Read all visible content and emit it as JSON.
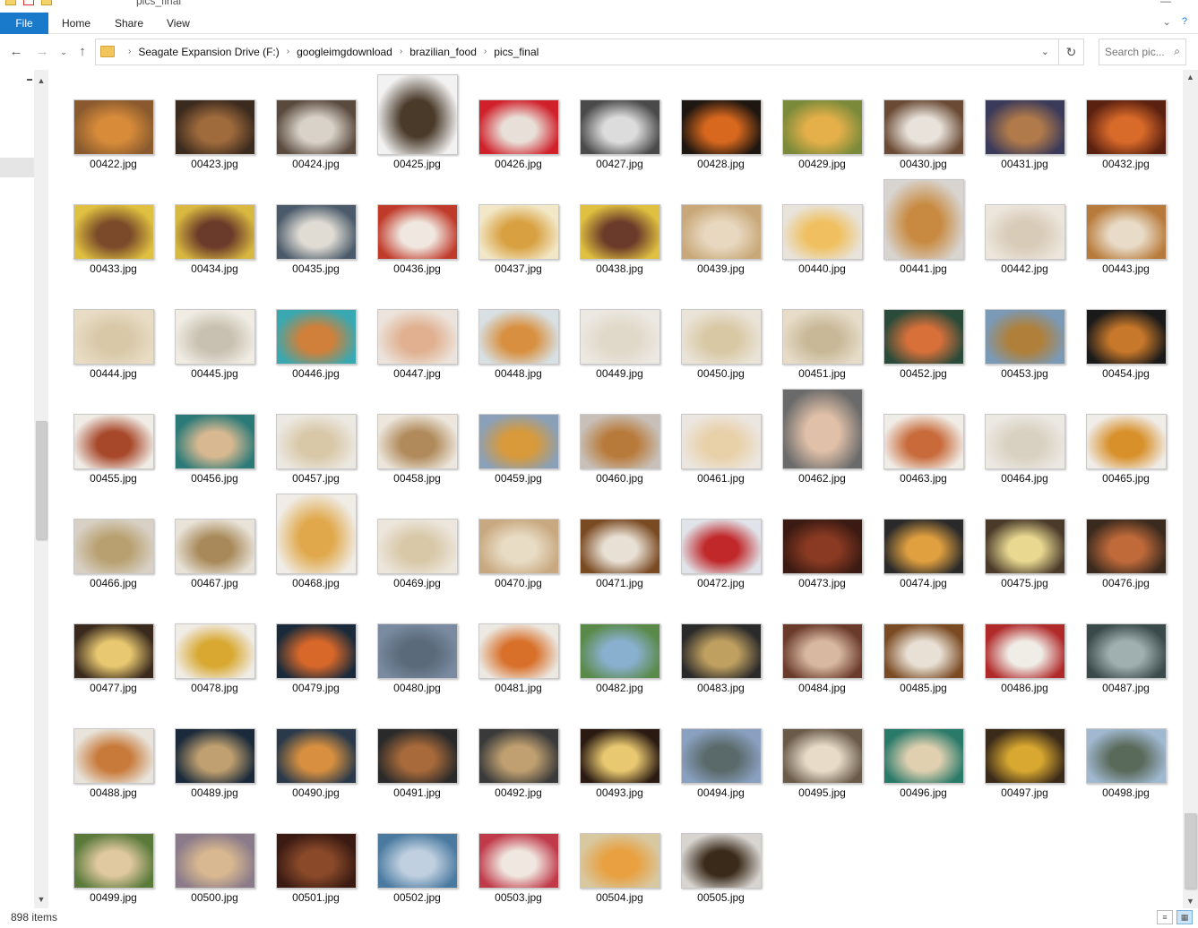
{
  "window": {
    "title": "pics_final"
  },
  "ribbon": {
    "tabs": [
      {
        "label": "File"
      },
      {
        "label": "Home"
      },
      {
        "label": "Share"
      },
      {
        "label": "View"
      }
    ]
  },
  "address": {
    "breadcrumbs": [
      "Seagate Expansion Drive (F:)",
      "googleimgdownload",
      "brazilian_food",
      "pics_final"
    ]
  },
  "search": {
    "placeholder": "Search pic..."
  },
  "status": {
    "item_count": "898 items"
  },
  "files": [
    {
      "name": "00422.jpg",
      "c1": "#8a5a2e",
      "c2": "#d88c3a"
    },
    {
      "name": "00423.jpg",
      "c1": "#3b2a1e",
      "c2": "#a06b3c"
    },
    {
      "name": "00424.jpg",
      "c1": "#5a4a3e",
      "c2": "#d9d2c9"
    },
    {
      "name": "00425.jpg",
      "c1": "#f2f2f2",
      "c2": "#4a3a2a",
      "tall": true
    },
    {
      "name": "00426.jpg",
      "c1": "#d0202a",
      "c2": "#e8e0d8"
    },
    {
      "name": "00427.jpg",
      "c1": "#4a4a4a",
      "c2": "#dcdcdc"
    },
    {
      "name": "00428.jpg",
      "c1": "#1e1610",
      "c2": "#d8681e"
    },
    {
      "name": "00429.jpg",
      "c1": "#7a8a3a",
      "c2": "#e5b04a"
    },
    {
      "name": "00430.jpg",
      "c1": "#6a4a34",
      "c2": "#e8e2da"
    },
    {
      "name": "00431.jpg",
      "c1": "#3a3a5a",
      "c2": "#b07a4a"
    },
    {
      "name": "00432.jpg",
      "c1": "#5a2010",
      "c2": "#d86a2a"
    },
    {
      "name": "00433.jpg",
      "c1": "#e0c040",
      "c2": "#7a4a2a"
    },
    {
      "name": "00434.jpg",
      "c1": "#d8b840",
      "c2": "#6a3a2a"
    },
    {
      "name": "00435.jpg",
      "c1": "#4a5a6a",
      "c2": "#e0dcd4"
    },
    {
      "name": "00436.jpg",
      "c1": "#c03a2a",
      "c2": "#f0e8e0"
    },
    {
      "name": "00437.jpg",
      "c1": "#f2e8c8",
      "c2": "#d8a040"
    },
    {
      "name": "00438.jpg",
      "c1": "#e0c040",
      "c2": "#6a3a2a"
    },
    {
      "name": "00439.jpg",
      "c1": "#c8a878",
      "c2": "#e8d8c0"
    },
    {
      "name": "00440.jpg",
      "c1": "#e8e4dc",
      "c2": "#f0c060"
    },
    {
      "name": "00441.jpg",
      "c1": "#d8d4d0",
      "c2": "#c88a40",
      "tall": true
    },
    {
      "name": "00442.jpg",
      "c1": "#ece6dc",
      "c2": "#d8cbb8"
    },
    {
      "name": "00443.jpg",
      "c1": "#b87a3a",
      "c2": "#e8dcc8"
    },
    {
      "name": "00444.jpg",
      "c1": "#e8dcc4",
      "c2": "#d8c8a8"
    },
    {
      "name": "00445.jpg",
      "c1": "#f0ece4",
      "c2": "#c8c0b0"
    },
    {
      "name": "00446.jpg",
      "c1": "#3aa8b0",
      "c2": "#d0803a"
    },
    {
      "name": "00447.jpg",
      "c1": "#ece4dc",
      "c2": "#e0b090"
    },
    {
      "name": "00448.jpg",
      "c1": "#d8e0e4",
      "c2": "#d89040"
    },
    {
      "name": "00449.jpg",
      "c1": "#ece8e2",
      "c2": "#e0d8c8"
    },
    {
      "name": "00450.jpg",
      "c1": "#eae4d8",
      "c2": "#d8c8a4"
    },
    {
      "name": "00451.jpg",
      "c1": "#e6dcc8",
      "c2": "#c8b898"
    },
    {
      "name": "00452.jpg",
      "c1": "#2a4a3a",
      "c2": "#d8703a"
    },
    {
      "name": "00453.jpg",
      "c1": "#7a9ab8",
      "c2": "#b0803a"
    },
    {
      "name": "00454.jpg",
      "c1": "#1a1a1a",
      "c2": "#c8782a"
    },
    {
      "name": "00455.jpg",
      "c1": "#f0ece6",
      "c2": "#a8482a"
    },
    {
      "name": "00456.jpg",
      "c1": "#2a7a78",
      "c2": "#d8b890"
    },
    {
      "name": "00457.jpg",
      "c1": "#ece8e2",
      "c2": "#d8c8a8"
    },
    {
      "name": "00458.jpg",
      "c1": "#ece6dc",
      "c2": "#b08a5a"
    },
    {
      "name": "00459.jpg",
      "c1": "#8aa0b8",
      "c2": "#d89a3a"
    },
    {
      "name": "00460.jpg",
      "c1": "#c8c0b8",
      "c2": "#b87a3a"
    },
    {
      "name": "00461.jpg",
      "c1": "#ece6e0",
      "c2": "#e8d0a8"
    },
    {
      "name": "00462.jpg",
      "c1": "#6a6a6a",
      "c2": "#e0c0a8",
      "tall": true
    },
    {
      "name": "00463.jpg",
      "c1": "#f0ece6",
      "c2": "#c86a3a"
    },
    {
      "name": "00464.jpg",
      "c1": "#ece8e2",
      "c2": "#d8d0c0"
    },
    {
      "name": "00465.jpg",
      "c1": "#f0ece8",
      "c2": "#d8902a"
    },
    {
      "name": "00466.jpg",
      "c1": "#d8d0c4",
      "c2": "#b8a070"
    },
    {
      "name": "00467.jpg",
      "c1": "#e8e2d8",
      "c2": "#a88a5a"
    },
    {
      "name": "00468.jpg",
      "c1": "#f0ece6",
      "c2": "#e0a84a",
      "tall": true
    },
    {
      "name": "00469.jpg",
      "c1": "#ece6dc",
      "c2": "#d8c8a8"
    },
    {
      "name": "00470.jpg",
      "c1": "#c8a880",
      "c2": "#e8dcc4"
    },
    {
      "name": "00471.jpg",
      "c1": "#7a4a22",
      "c2": "#e8e0d4"
    },
    {
      "name": "00472.jpg",
      "c1": "#e0e4ea",
      "c2": "#c0282a"
    },
    {
      "name": "00473.jpg",
      "c1": "#3a1a12",
      "c2": "#8a3a22"
    },
    {
      "name": "00474.jpg",
      "c1": "#2a2a2a",
      "c2": "#e0a040"
    },
    {
      "name": "00475.jpg",
      "c1": "#4a3a2a",
      "c2": "#e8d890"
    },
    {
      "name": "00476.jpg",
      "c1": "#3a2a1e",
      "c2": "#c06a3a"
    },
    {
      "name": "00477.jpg",
      "c1": "#3a2a1e",
      "c2": "#e8c870"
    },
    {
      "name": "00478.jpg",
      "c1": "#f0ece6",
      "c2": "#d8a830"
    },
    {
      "name": "00479.jpg",
      "c1": "#1a2a3a",
      "c2": "#d8682a"
    },
    {
      "name": "00480.jpg",
      "c1": "#7a8aa0",
      "c2": "#5a6a7a"
    },
    {
      "name": "00481.jpg",
      "c1": "#ece8e2",
      "c2": "#d8702a"
    },
    {
      "name": "00482.jpg",
      "c1": "#5a8a4a",
      "c2": "#8ab0d0"
    },
    {
      "name": "00483.jpg",
      "c1": "#2a2a2a",
      "c2": "#c0a060"
    },
    {
      "name": "00484.jpg",
      "c1": "#6a3a2a",
      "c2": "#d8b8a0"
    },
    {
      "name": "00485.jpg",
      "c1": "#7a4a22",
      "c2": "#e8e0d4"
    },
    {
      "name": "00486.jpg",
      "c1": "#b02a2a",
      "c2": "#f0ece6"
    },
    {
      "name": "00487.jpg",
      "c1": "#3a4a4a",
      "c2": "#a0b0b0"
    },
    {
      "name": "00488.jpg",
      "c1": "#e8e4dc",
      "c2": "#c87a3a"
    },
    {
      "name": "00489.jpg",
      "c1": "#1a2a3a",
      "c2": "#c0a070"
    },
    {
      "name": "00490.jpg",
      "c1": "#2a3a4a",
      "c2": "#d89040"
    },
    {
      "name": "00491.jpg",
      "c1": "#2a2a2a",
      "c2": "#a86a3a"
    },
    {
      "name": "00492.jpg",
      "c1": "#3a3a3a",
      "c2": "#c0a070"
    },
    {
      "name": "00493.jpg",
      "c1": "#2a1a12",
      "c2": "#e8c870"
    },
    {
      "name": "00494.jpg",
      "c1": "#8aa0c0",
      "c2": "#5a6a6a"
    },
    {
      "name": "00495.jpg",
      "c1": "#6a5a4a",
      "c2": "#e8dcc8"
    },
    {
      "name": "00496.jpg",
      "c1": "#2a7a6a",
      "c2": "#e0d0b0"
    },
    {
      "name": "00497.jpg",
      "c1": "#3a2a1a",
      "c2": "#d8a830"
    },
    {
      "name": "00498.jpg",
      "c1": "#a0b8d0",
      "c2": "#5a6a5a"
    },
    {
      "name": "00499.jpg",
      "c1": "#5a7a3a",
      "c2": "#e0c8a0"
    },
    {
      "name": "00500.jpg",
      "c1": "#8a7a8a",
      "c2": "#d8b890"
    },
    {
      "name": "00501.jpg",
      "c1": "#3a1a12",
      "c2": "#8a4a2a"
    },
    {
      "name": "00502.jpg",
      "c1": "#4a7aa0",
      "c2": "#c0d0e0"
    },
    {
      "name": "00503.jpg",
      "c1": "#c03a4a",
      "c2": "#f0e8e0"
    },
    {
      "name": "00504.jpg",
      "c1": "#d8c8a0",
      "c2": "#e8a040"
    },
    {
      "name": "00505.jpg",
      "c1": "#d8d4d0",
      "c2": "#3a2a1a"
    }
  ]
}
